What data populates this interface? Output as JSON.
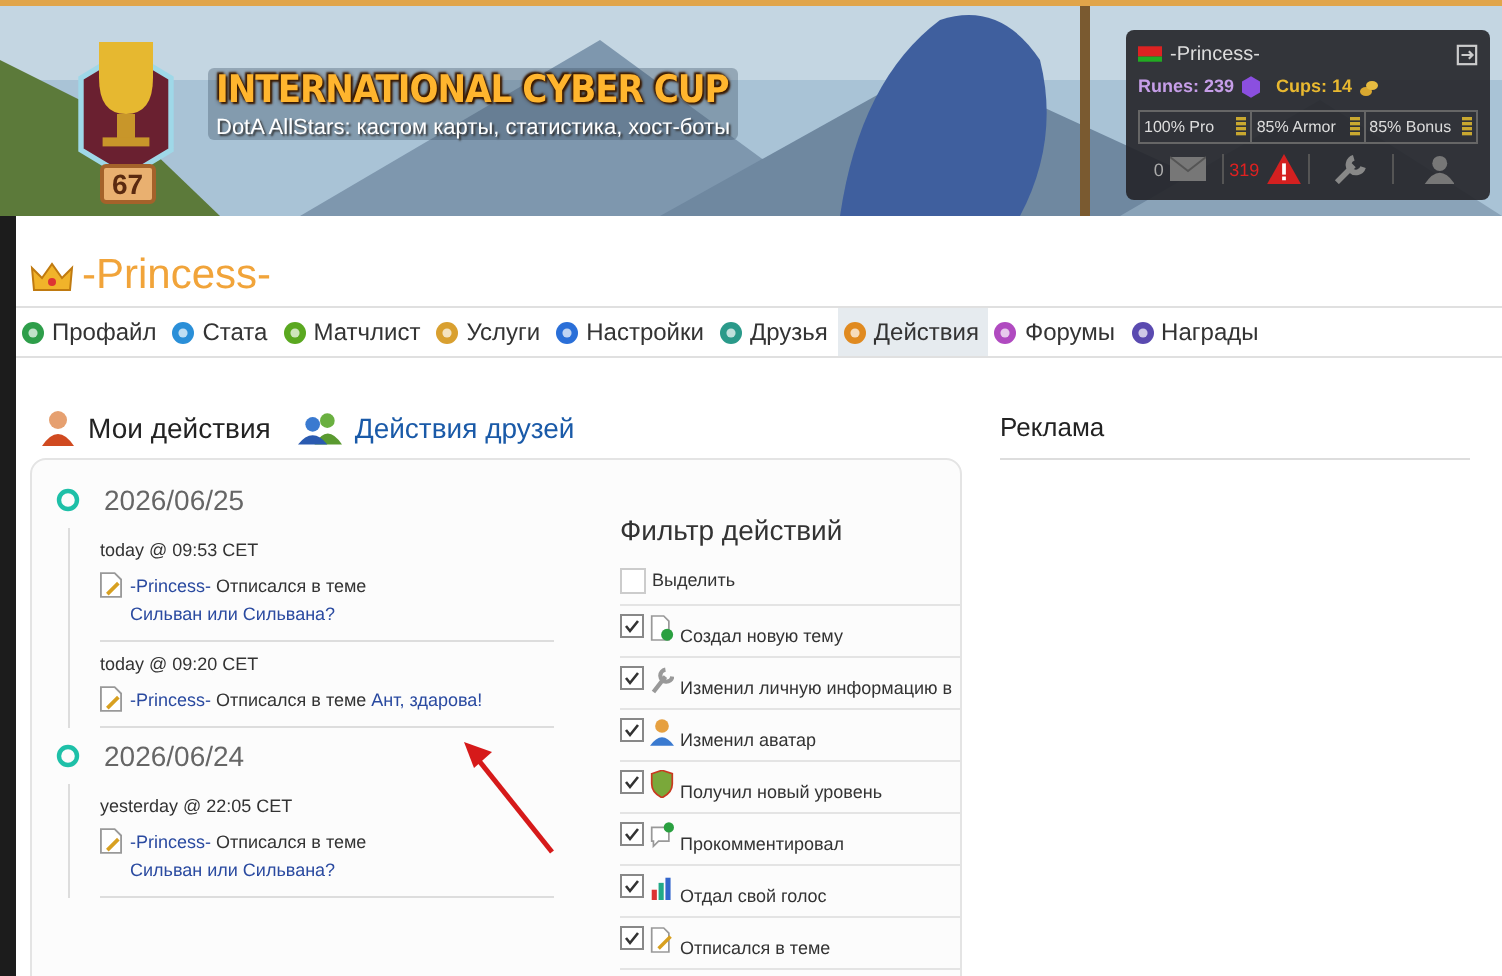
{
  "banner": {
    "title": "INTERNATIONAL CYBER CUP",
    "subtitle": "DotA AllStars: кастом карты, статистика, хост-боты",
    "level": "67"
  },
  "user_panel": {
    "name": "-Princess-",
    "runes": "Runes: 239",
    "cups": "Cups: 14",
    "stats": [
      "100% Pro",
      "85% Armor",
      "85% Bonus"
    ],
    "messages": "0",
    "alerts": "319"
  },
  "profile": {
    "name": "-Princess-"
  },
  "tabs": [
    {
      "label": "Профайл",
      "kind": "profile",
      "selected": false
    },
    {
      "label": "Стата",
      "kind": "stats",
      "selected": false
    },
    {
      "label": "Матчлист",
      "kind": "matchlist",
      "selected": false
    },
    {
      "label": "Услуги",
      "kind": "services",
      "selected": false
    },
    {
      "label": "Настройки",
      "kind": "settings",
      "selected": false
    },
    {
      "label": "Друзья",
      "kind": "friends",
      "selected": false
    },
    {
      "label": "Действия",
      "kind": "actions",
      "selected": true
    },
    {
      "label": "Форумы",
      "kind": "forums",
      "selected": false
    },
    {
      "label": "Награды",
      "kind": "awards",
      "selected": false
    }
  ],
  "sections": [
    {
      "label": "Мои действия",
      "kind": "me"
    },
    {
      "label": "Действия друзей",
      "kind": "friends"
    }
  ],
  "timeline": [
    {
      "date": "2026/06/25",
      "entries": [
        {
          "time": "today @ 09:53 CET",
          "user": "-Princess-",
          "action": "Отписался в теме",
          "topic": "Сильван или Сильвана?"
        },
        {
          "time": "today @ 09:20 CET",
          "user": "-Princess-",
          "action": "Отписался в теме",
          "topic": "Ант, здарова!"
        }
      ]
    },
    {
      "date": "2026/06/24",
      "entries": [
        {
          "time": "yesterday @ 22:05 CET",
          "user": "-Princess-",
          "action": "Отписался в теме",
          "topic": "Сильван или Сильвана?"
        }
      ]
    }
  ],
  "filter": {
    "title": "Фильтр действий",
    "select_all": {
      "label": "Выделить",
      "checked": false
    },
    "items": [
      {
        "label": "Создал новую тему",
        "kind": "new-topic",
        "checked": true
      },
      {
        "label": "Изменил личную информацию в",
        "kind": "wrench",
        "checked": true
      },
      {
        "label": "Изменил аватар",
        "kind": "avatar",
        "checked": true
      },
      {
        "label": "Получил новый уровень",
        "kind": "shield",
        "checked": true
      },
      {
        "label": "Прокомментировал",
        "kind": "comment",
        "checked": true
      },
      {
        "label": "Отдал свой голос",
        "kind": "chart",
        "checked": true
      },
      {
        "label": "Отписался в теме",
        "kind": "post",
        "checked": true
      }
    ]
  },
  "ads": {
    "title": "Реклама"
  }
}
